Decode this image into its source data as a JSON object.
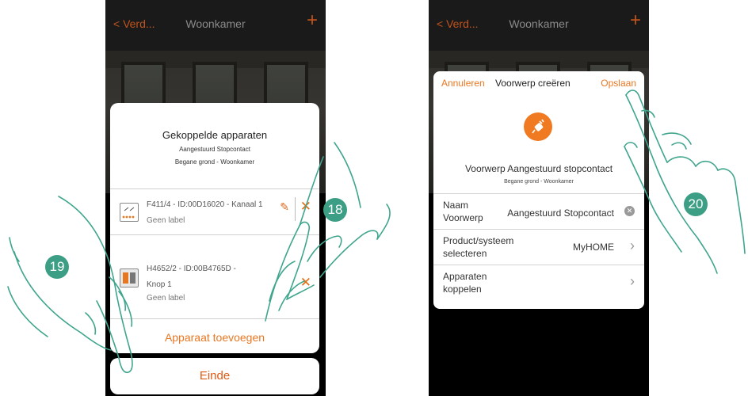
{
  "left_screen": {
    "nav": {
      "back": "< Verd...",
      "title": "Woonkamer",
      "plus": "+"
    },
    "dialog": {
      "title": "Gekoppelde apparaten",
      "subtitle": "Aangestuurd Stopcontact",
      "location": "Begane grond - Woonkamer",
      "devices": [
        {
          "name": "F411/4 - ID:00D16020 - Kanaal 1",
          "label": "Geen label",
          "icon": "relay-module-icon"
        },
        {
          "name": "H4652/2 - ID:00B4765D - Knop 1",
          "label": "Geen label",
          "icon": "pushbutton-icon"
        }
      ],
      "add_device": "Apparaat toevoegen"
    },
    "end_button": "Einde"
  },
  "right_screen": {
    "nav": {
      "back": "< Verd...",
      "title": "Woonkamer",
      "plus": "+"
    },
    "dialog": {
      "cancel": "Annuleren",
      "title": "Voorwerp creëren",
      "save": "Opslaan",
      "icon": "plug-icon",
      "object_name": "Voorwerp Aangestuurd stopcontact",
      "location": "Begane grond - Woonkamer",
      "rows": [
        {
          "label": "Naam Voorwerp",
          "value": "Aangestuurd Stopcontact"
        },
        {
          "label": "Product/systeem selecteren",
          "value": "MyHOME"
        },
        {
          "label": "Apparaten koppelen",
          "value": ""
        }
      ]
    }
  },
  "step_badges": [
    "18",
    "19",
    "20"
  ],
  "colors": {
    "accent": "#e87722",
    "badge": "#3c9f85",
    "nav": "#1a1a1a"
  }
}
